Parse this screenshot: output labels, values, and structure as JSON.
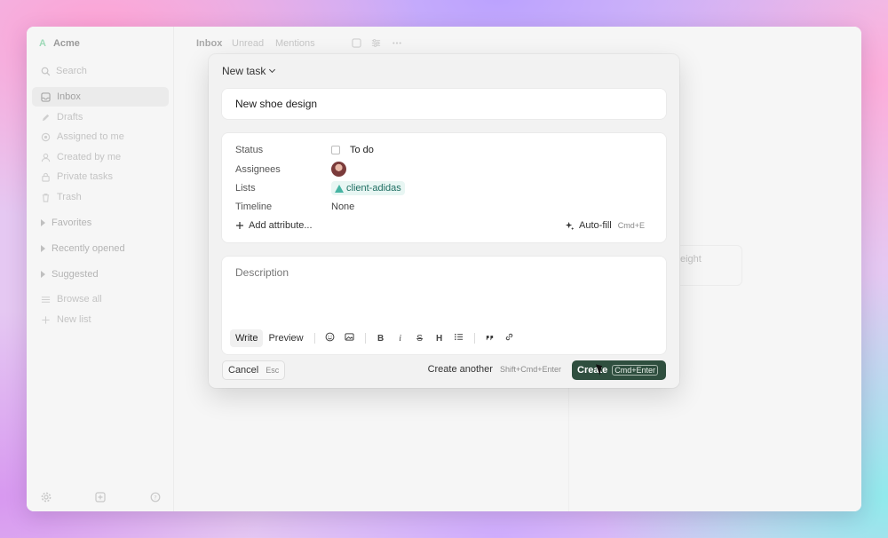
{
  "workspace": {
    "name": "Acme",
    "logo_letter": "A"
  },
  "sidebar": {
    "search_placeholder": "Search",
    "items": [
      {
        "label": "Inbox",
        "icon": "inbox-icon",
        "active": true
      },
      {
        "label": "Drafts",
        "icon": "pencil-icon"
      },
      {
        "label": "Assigned to me",
        "icon": "target-icon"
      },
      {
        "label": "Created by me",
        "icon": "user-icon"
      },
      {
        "label": "Private tasks",
        "icon": "lock-icon"
      },
      {
        "label": "Trash",
        "icon": "trash-icon"
      }
    ],
    "sections": [
      "Favorites",
      "Recently opened",
      "Suggested"
    ],
    "links": [
      {
        "label": "Browse all",
        "icon": "list-icon"
      },
      {
        "label": "New list",
        "icon": "plus-icon"
      }
    ]
  },
  "main": {
    "tabs": [
      "Inbox",
      "Unread",
      "Mentions"
    ],
    "background_card_text": "eight"
  },
  "modal": {
    "type_label": "New task",
    "title_value": "New shoe design",
    "attributes": {
      "status": {
        "label": "Status",
        "value": "To do"
      },
      "assignees": {
        "label": "Assignees"
      },
      "lists": {
        "label": "Lists",
        "value": "client-adidas"
      },
      "timeline": {
        "label": "Timeline",
        "value": "None"
      }
    },
    "add_attribute_label": "Add attribute...",
    "auto_fill": {
      "label": "Auto-fill",
      "shortcut": "Cmd+E"
    },
    "description_placeholder": "Description",
    "editor": {
      "write_label": "Write",
      "preview_label": "Preview",
      "bold": "B",
      "italic": "i",
      "strike": "S",
      "heading": "H"
    },
    "footer": {
      "cancel_label": "Cancel",
      "cancel_shortcut": "Esc",
      "create_another_label": "Create another",
      "create_another_shortcut": "Shift+Cmd+Enter",
      "create_label": "Create",
      "create_shortcut": "Cmd+Enter"
    }
  },
  "colors": {
    "primary_button": "#2f4f3f",
    "list_chip_bg": "#e8f6f3",
    "list_chip_text": "#1f6e62"
  }
}
